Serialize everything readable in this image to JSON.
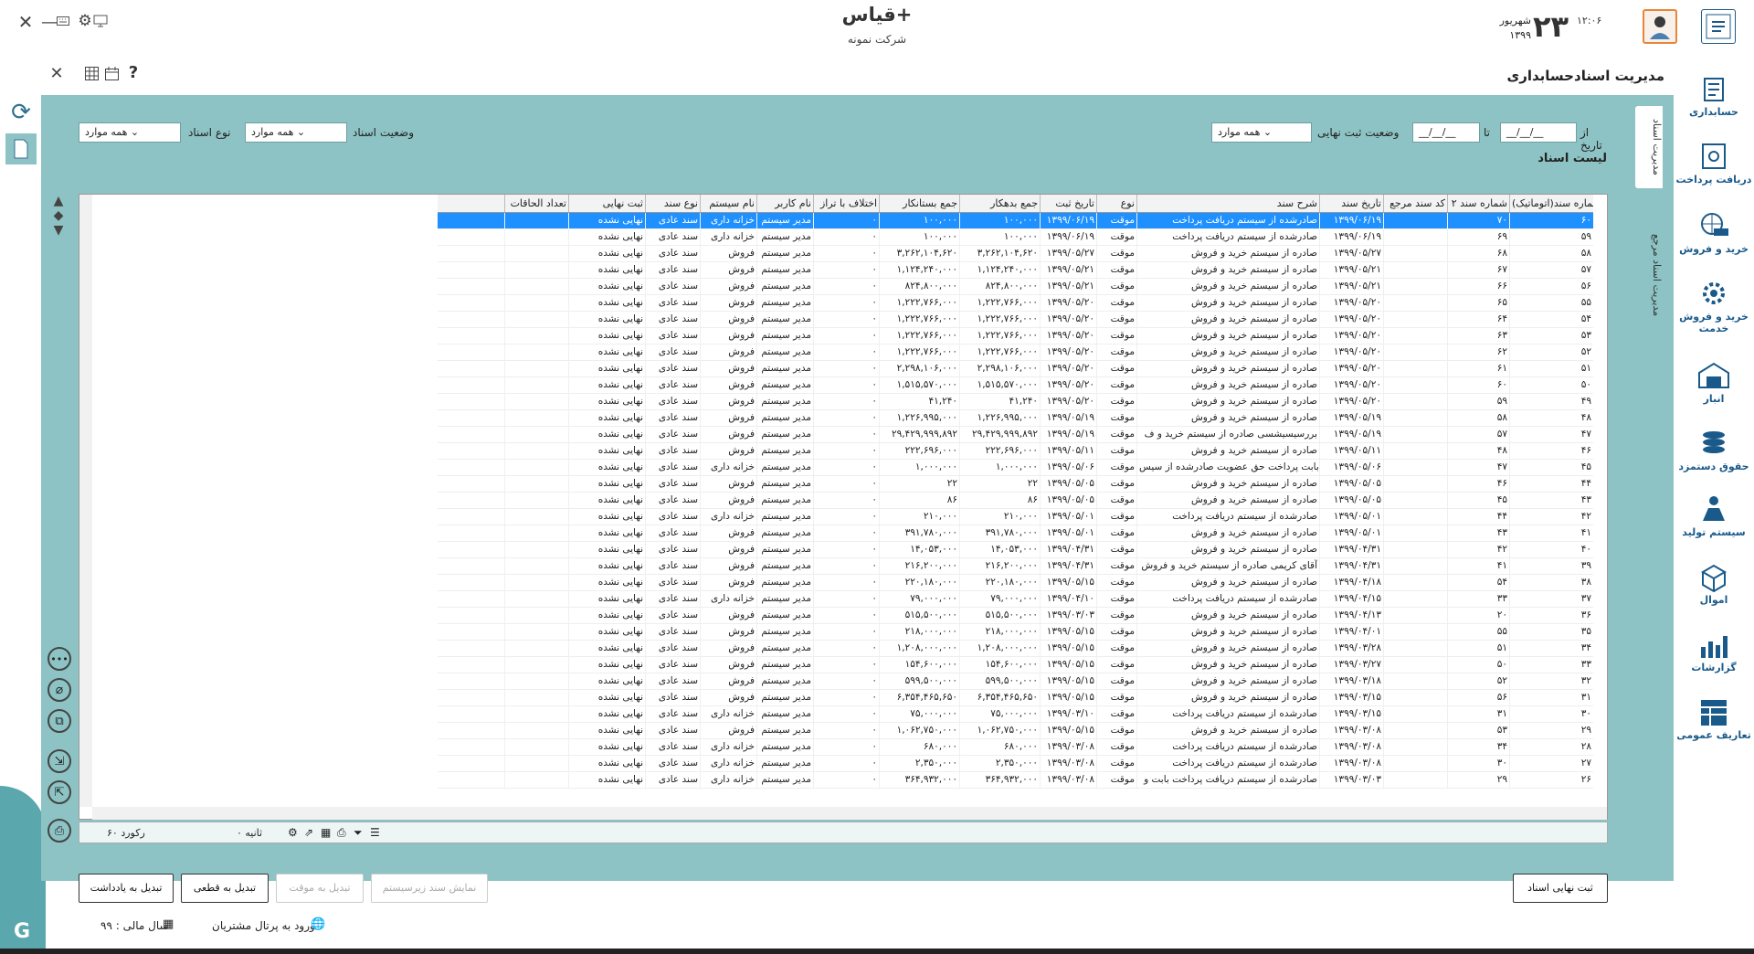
{
  "app": {
    "title": "قیاس+",
    "company": "شرکت نمونه",
    "day": "۲۳",
    "month": "شهریور",
    "year": "۱۳۹۹",
    "time": "۱۲:۰۶"
  },
  "page": {
    "title": "مدیریت اسنادحسابداری"
  },
  "sidebar": [
    "حسابداری",
    "دریافت پرداخت",
    "خرید و فروش",
    "خرید و فروش خدمت",
    "انبار",
    "حقوق دستمزد",
    "سیستم تولید",
    "اموال",
    "گزارشات",
    "تعاریف عمومی"
  ],
  "vtabs": [
    "مدیریت اسناد",
    "مدیریت اسناد مرجع"
  ],
  "filters": {
    "from_label": "از تاریخ",
    "to_label": "تا",
    "from_value": "__/__/__",
    "to_value": "__/__/__",
    "final_status_label": "وضعیت ثبت نهایی",
    "final_status_value": "همه موارد",
    "doc_status_label": "وضعیت اسناد",
    "doc_status_value": "همه موارد",
    "doc_type_label": "نوع اسناد",
    "doc_type_value": "همه موارد"
  },
  "list_title": "لیست اسناد",
  "columns": [
    "شماره سند(اتوماتیک)",
    "شماره سند ۲",
    "کد سند مرجع",
    "تاریخ سند",
    "شرح سند",
    "نوع",
    "تاریخ ثبت",
    "جمع بدهکار",
    "جمع بستانکار",
    "اختلاف با تراز",
    "نام کاربر",
    "نام سیستم",
    "نوع سند",
    "ثبت نهایی",
    "تعداد الحاقات"
  ],
  "rows": [
    [
      "۶۰",
      "۷۰",
      "",
      "۱۳۹۹/۰۶/۱۹",
      "صادرشده از سیستم دریافت پرداخت",
      "موقت",
      "۱۳۹۹/۰۶/۱۹",
      "۱۰۰,۰۰۰",
      "۱۰۰,۰۰۰",
      "۰",
      "مدیر سیستم",
      "خزانه داری",
      "سند عادی",
      "نهایی نشده",
      ""
    ],
    [
      "۵۹",
      "۶۹",
      "",
      "۱۳۹۹/۰۶/۱۹",
      "صادرشده از سیستم دریافت پرداخت",
      "موقت",
      "۱۳۹۹/۰۶/۱۹",
      "۱۰۰,۰۰۰",
      "۱۰۰,۰۰۰",
      "۰",
      "مدیر سیستم",
      "خزانه داری",
      "سند عادی",
      "نهایی نشده",
      ""
    ],
    [
      "۵۸",
      "۶۸",
      "",
      "۱۳۹۹/۰۵/۲۷",
      "صادره از سیستم خرید و فروش",
      "موقت",
      "۱۳۹۹/۰۵/۲۷",
      "۳,۲۶۲,۱۰۴,۶۲۰",
      "۳,۲۶۲,۱۰۴,۶۲۰",
      "۰",
      "مدیر سیستم",
      "فروش",
      "سند عادی",
      "نهایی نشده",
      ""
    ],
    [
      "۵۷",
      "۶۷",
      "",
      "۱۳۹۹/۰۵/۲۱",
      "صادره از سیستم خرید و فروش",
      "موقت",
      "۱۳۹۹/۰۵/۲۱",
      "۱,۱۲۴,۲۴۰,۰۰۰",
      "۱,۱۲۴,۲۴۰,۰۰۰",
      "۰",
      "مدیر سیستم",
      "فروش",
      "سند عادی",
      "نهایی نشده",
      ""
    ],
    [
      "۵۶",
      "۶۶",
      "",
      "۱۳۹۹/۰۵/۲۱",
      "صادره از سیستم خرید و فروش",
      "موقت",
      "۱۳۹۹/۰۵/۲۱",
      "۸۲۴,۸۰۰,۰۰۰",
      "۸۲۴,۸۰۰,۰۰۰",
      "۰",
      "مدیر سیستم",
      "فروش",
      "سند عادی",
      "نهایی نشده",
      ""
    ],
    [
      "۵۵",
      "۶۵",
      "",
      "۱۳۹۹/۰۵/۲۰",
      "صادره از سیستم خرید و فروش",
      "موقت",
      "۱۳۹۹/۰۵/۲۰",
      "۱,۲۲۲,۷۶۶,۰۰۰",
      "۱,۲۲۲,۷۶۶,۰۰۰",
      "۰",
      "مدیر سیستم",
      "فروش",
      "سند عادی",
      "نهایی نشده",
      ""
    ],
    [
      "۵۴",
      "۶۴",
      "",
      "۱۳۹۹/۰۵/۲۰",
      "صادره از سیستم خرید و فروش",
      "موقت",
      "۱۳۹۹/۰۵/۲۰",
      "۱,۲۲۲,۷۶۶,۰۰۰",
      "۱,۲۲۲,۷۶۶,۰۰۰",
      "۰",
      "مدیر سیستم",
      "فروش",
      "سند عادی",
      "نهایی نشده",
      ""
    ],
    [
      "۵۳",
      "۶۳",
      "",
      "۱۳۹۹/۰۵/۲۰",
      "صادره از سیستم خرید و فروش",
      "موقت",
      "۱۳۹۹/۰۵/۲۰",
      "۱,۲۲۲,۷۶۶,۰۰۰",
      "۱,۲۲۲,۷۶۶,۰۰۰",
      "۰",
      "مدیر سیستم",
      "فروش",
      "سند عادی",
      "نهایی نشده",
      ""
    ],
    [
      "۵۲",
      "۶۲",
      "",
      "۱۳۹۹/۰۵/۲۰",
      "صادره از سیستم خرید و فروش",
      "موقت",
      "۱۳۹۹/۰۵/۲۰",
      "۱,۲۲۲,۷۶۶,۰۰۰",
      "۱,۲۲۲,۷۶۶,۰۰۰",
      "۰",
      "مدیر سیستم",
      "فروش",
      "سند عادی",
      "نهایی نشده",
      ""
    ],
    [
      "۵۱",
      "۶۱",
      "",
      "۱۳۹۹/۰۵/۲۰",
      "صادره از سیستم خرید و فروش",
      "موقت",
      "۱۳۹۹/۰۵/۲۰",
      "۲,۲۹۸,۱۰۶,۰۰۰",
      "۲,۲۹۸,۱۰۶,۰۰۰",
      "۰",
      "مدیر سیستم",
      "فروش",
      "سند عادی",
      "نهایی نشده",
      ""
    ],
    [
      "۵۰",
      "۶۰",
      "",
      "۱۳۹۹/۰۵/۲۰",
      "صادره از سیستم خرید و فروش",
      "موقت",
      "۱۳۹۹/۰۵/۲۰",
      "۱,۵۱۵,۵۷۰,۰۰۰",
      "۱,۵۱۵,۵۷۰,۰۰۰",
      "۰",
      "مدیر سیستم",
      "فروش",
      "سند عادی",
      "نهایی نشده",
      ""
    ],
    [
      "۴۹",
      "۵۹",
      "",
      "۱۳۹۹/۰۵/۲۰",
      "صادره از سیستم خرید و فروش",
      "موقت",
      "۱۳۹۹/۰۵/۲۰",
      "۴۱,۲۴۰",
      "۴۱,۲۴۰",
      "۰",
      "مدیر سیستم",
      "فروش",
      "سند عادی",
      "نهایی نشده",
      ""
    ],
    [
      "۴۸",
      "۵۸",
      "",
      "۱۳۹۹/۰۵/۱۹",
      "صادره از سیستم خرید و فروش",
      "موقت",
      "۱۳۹۹/۰۵/۱۹",
      "۱,۲۲۶,۹۹۵,۰۰۰",
      "۱,۲۲۶,۹۹۵,۰۰۰",
      "۰",
      "مدیر سیستم",
      "فروش",
      "سند عادی",
      "نهایی نشده",
      ""
    ],
    [
      "۴۷",
      "۵۷",
      "",
      "۱۳۹۹/۰۵/۱۹",
      "بررسیسیشسی صادره از سیستم خرید و ف",
      "موقت",
      "۱۳۹۹/۰۵/۱۹",
      "۲۹,۴۲۹,۹۹۹,۸۹۲",
      "۲۹,۴۲۹,۹۹۹,۸۹۲",
      "۰",
      "مدیر سیستم",
      "فروش",
      "سند عادی",
      "نهایی نشده",
      ""
    ],
    [
      "۴۶",
      "۴۸",
      "",
      "۱۳۹۹/۰۵/۱۱",
      "صادره از سیستم خرید و فروش",
      "موقت",
      "۱۳۹۹/۰۵/۱۱",
      "۲۲۲,۶۹۶,۰۰۰",
      "۲۲۲,۶۹۶,۰۰۰",
      "۰",
      "مدیر سیستم",
      "فروش",
      "سند عادی",
      "نهایی نشده",
      ""
    ],
    [
      "۴۵",
      "۴۷",
      "",
      "۱۳۹۹/۰۵/۰۶",
      "بابت پرداخت حق عضویت صادرشده از سیس",
      "موقت",
      "۱۳۹۹/۰۵/۰۶",
      "۱,۰۰۰,۰۰۰",
      "۱,۰۰۰,۰۰۰",
      "۰",
      "مدیر سیستم",
      "خزانه داری",
      "سند عادی",
      "نهایی نشده",
      ""
    ],
    [
      "۴۴",
      "۴۶",
      "",
      "۱۳۹۹/۰۵/۰۵",
      "صادره از سیستم خرید و فروش",
      "موقت",
      "۱۳۹۹/۰۵/۰۵",
      "۲۲",
      "۲۲",
      "۰",
      "مدیر سیستم",
      "فروش",
      "سند عادی",
      "نهایی نشده",
      ""
    ],
    [
      "۴۳",
      "۴۵",
      "",
      "۱۳۹۹/۰۵/۰۵",
      "صادره از سیستم خرید و فروش",
      "موقت",
      "۱۳۹۹/۰۵/۰۵",
      "۸۶",
      "۸۶",
      "۰",
      "مدیر سیستم",
      "فروش",
      "سند عادی",
      "نهایی نشده",
      ""
    ],
    [
      "۴۲",
      "۴۴",
      "",
      "۱۳۹۹/۰۵/۰۱",
      "صادرشده از سیستم دریافت پرداخت",
      "موقت",
      "۱۳۹۹/۰۵/۰۱",
      "۲۱۰,۰۰۰",
      "۲۱۰,۰۰۰",
      "۰",
      "مدیر سیستم",
      "خزانه داری",
      "سند عادی",
      "نهایی نشده",
      ""
    ],
    [
      "۴۱",
      "۴۳",
      "",
      "۱۳۹۹/۰۵/۰۱",
      "صادره از سیستم خرید و فروش",
      "موقت",
      "۱۳۹۹/۰۵/۰۱",
      "۳۹۱,۷۸۰,۰۰۰",
      "۳۹۱,۷۸۰,۰۰۰",
      "۰",
      "مدیر سیستم",
      "فروش",
      "سند عادی",
      "نهایی نشده",
      ""
    ],
    [
      "۴۰",
      "۴۲",
      "",
      "۱۳۹۹/۰۴/۳۱",
      "صادره از سیستم خرید و فروش",
      "موقت",
      "۱۳۹۹/۰۴/۳۱",
      "۱۴,۰۵۳,۰۰۰",
      "۱۴,۰۵۳,۰۰۰",
      "۰",
      "مدیر سیستم",
      "فروش",
      "سند عادی",
      "نهایی نشده",
      ""
    ],
    [
      "۳۹",
      "۴۱",
      "",
      "۱۳۹۹/۰۴/۳۱",
      "آقای کریمی صادره از سیستم خرید و فروش",
      "موقت",
      "۱۳۹۹/۰۴/۳۱",
      "۲۱۶,۲۰۰,۰۰۰",
      "۲۱۶,۲۰۰,۰۰۰",
      "۰",
      "مدیر سیستم",
      "فروش",
      "سند عادی",
      "نهایی نشده",
      ""
    ],
    [
      "۳۸",
      "۵۴",
      "",
      "۱۳۹۹/۰۴/۱۸",
      "صادره از سیستم خرید و فروش",
      "موقت",
      "۱۳۹۹/۰۵/۱۵",
      "۲۲۰,۱۸۰,۰۰۰",
      "۲۲۰,۱۸۰,۰۰۰",
      "۰",
      "مدیر سیستم",
      "فروش",
      "سند عادی",
      "نهایی نشده",
      ""
    ],
    [
      "۳۷",
      "۳۳",
      "",
      "۱۳۹۹/۰۴/۱۵",
      "صادرشده از سیستم دریافت پرداخت",
      "موقت",
      "۱۳۹۹/۰۴/۱۰",
      "۷۹,۰۰۰,۰۰۰",
      "۷۹,۰۰۰,۰۰۰",
      "۰",
      "مدیر سیستم",
      "خزانه داری",
      "سند عادی",
      "نهایی نشده",
      ""
    ],
    [
      "۳۶",
      "۲۰",
      "",
      "۱۳۹۹/۰۴/۱۳",
      "صادره از سیستم خرید و فروش",
      "موقت",
      "۱۳۹۹/۰۳/۰۳",
      "۵۱۵,۵۰۰,۰۰۰",
      "۵۱۵,۵۰۰,۰۰۰",
      "۰",
      "مدیر سیستم",
      "فروش",
      "سند عادی",
      "نهایی نشده",
      ""
    ],
    [
      "۳۵",
      "۵۵",
      "",
      "۱۳۹۹/۰۴/۰۱",
      "صادره از سیستم خرید و فروش",
      "موقت",
      "۱۳۹۹/۰۵/۱۵",
      "۲۱۸,۰۰۰,۰۰۰",
      "۲۱۸,۰۰۰,۰۰۰",
      "۰",
      "مدیر سیستم",
      "فروش",
      "سند عادی",
      "نهایی نشده",
      ""
    ],
    [
      "۳۴",
      "۵۱",
      "",
      "۱۳۹۹/۰۳/۲۸",
      "صادره از سیستم خرید و فروش",
      "موقت",
      "۱۳۹۹/۰۵/۱۵",
      "۱,۲۰۸,۰۰۰,۰۰۰",
      "۱,۲۰۸,۰۰۰,۰۰۰",
      "۰",
      "مدیر سیستم",
      "فروش",
      "سند عادی",
      "نهایی نشده",
      ""
    ],
    [
      "۳۳",
      "۵۰",
      "",
      "۱۳۹۹/۰۳/۲۷",
      "صادره از سیستم خرید و فروش",
      "موقت",
      "۱۳۹۹/۰۵/۱۵",
      "۱۵۴,۶۰۰,۰۰۰",
      "۱۵۴,۶۰۰,۰۰۰",
      "۰",
      "مدیر سیستم",
      "فروش",
      "سند عادی",
      "نهایی نشده",
      ""
    ],
    [
      "۳۲",
      "۵۲",
      "",
      "۱۳۹۹/۰۳/۱۸",
      "صادره از سیستم خرید و فروش",
      "موقت",
      "۱۳۹۹/۰۵/۱۵",
      "۵۹۹,۵۰۰,۰۰۰",
      "۵۹۹,۵۰۰,۰۰۰",
      "۰",
      "مدیر سیستم",
      "فروش",
      "سند عادی",
      "نهایی نشده",
      ""
    ],
    [
      "۳۱",
      "۵۶",
      "",
      "۱۳۹۹/۰۳/۱۵",
      "صادره از سیستم خرید و فروش",
      "موقت",
      "۱۳۹۹/۰۵/۱۵",
      "۶,۳۵۴,۴۶۵,۶۵۰",
      "۶,۳۵۴,۴۶۵,۶۵۰",
      "۰",
      "مدیر سیستم",
      "فروش",
      "سند عادی",
      "نهایی نشده",
      ""
    ],
    [
      "۳۰",
      "۳۱",
      "",
      "۱۳۹۹/۰۳/۱۵",
      "صادرشده از سیستم دریافت پرداخت",
      "موقت",
      "۱۳۹۹/۰۳/۱۰",
      "۷۵,۰۰۰,۰۰۰",
      "۷۵,۰۰۰,۰۰۰",
      "۰",
      "مدیر سیستم",
      "خزانه داری",
      "سند عادی",
      "نهایی نشده",
      ""
    ],
    [
      "۲۹",
      "۵۳",
      "",
      "۱۳۹۹/۰۳/۰۸",
      "صادره از سیستم خرید و فروش",
      "موقت",
      "۱۳۹۹/۰۵/۱۵",
      "۱,۰۶۲,۷۵۰,۰۰۰",
      "۱,۰۶۲,۷۵۰,۰۰۰",
      "۰",
      "مدیر سیستم",
      "فروش",
      "سند عادی",
      "نهایی نشده",
      ""
    ],
    [
      "۲۸",
      "۳۴",
      "",
      "۱۳۹۹/۰۳/۰۸",
      "صادرشده از سیستم دریافت پرداخت",
      "موقت",
      "۱۳۹۹/۰۳/۰۸",
      "۶۸۰,۰۰۰",
      "۶۸۰,۰۰۰",
      "۰",
      "مدیر سیستم",
      "خزانه داری",
      "سند عادی",
      "نهایی نشده",
      ""
    ],
    [
      "۲۷",
      "۳۰",
      "",
      "۱۳۹۹/۰۳/۰۸",
      "صادرشده از سیستم دریافت پرداخت",
      "موقت",
      "۱۳۹۹/۰۳/۰۸",
      "۲,۳۵۰,۰۰۰",
      "۲,۳۵۰,۰۰۰",
      "۰",
      "مدیر سیستم",
      "خزانه داری",
      "سند عادی",
      "نهایی نشده",
      ""
    ],
    [
      "۲۶",
      "۲۹",
      "",
      "۱۳۹۹/۰۳/۰۳",
      "صادرشده از سیستم دریافت پرداخت بابت و",
      "موقت",
      "۱۳۹۹/۰۳/۰۸",
      "۳۶۴,۹۳۲,۰۰۰",
      "۳۶۴,۹۳۲,۰۰۰",
      "۰",
      "مدیر سیستم",
      "خزانه داری",
      "سند عادی",
      "نهایی نشده",
      ""
    ]
  ],
  "status": {
    "records": "۶۰ رکورد",
    "seconds": "۰ ثانیه"
  },
  "buttons": {
    "final_post": "ثبت نهایی اسناد",
    "show_sub": "نمایش سند زیرسیستم",
    "to_temp": "تبدیل به موقت",
    "to_final": "تبدیل به قطعی",
    "to_note": "تبدیل به یادداشت"
  },
  "footer": {
    "fiscal_year": "سال مالی : ۹۹",
    "portal": "ورود به پرتال مشتریان"
  }
}
